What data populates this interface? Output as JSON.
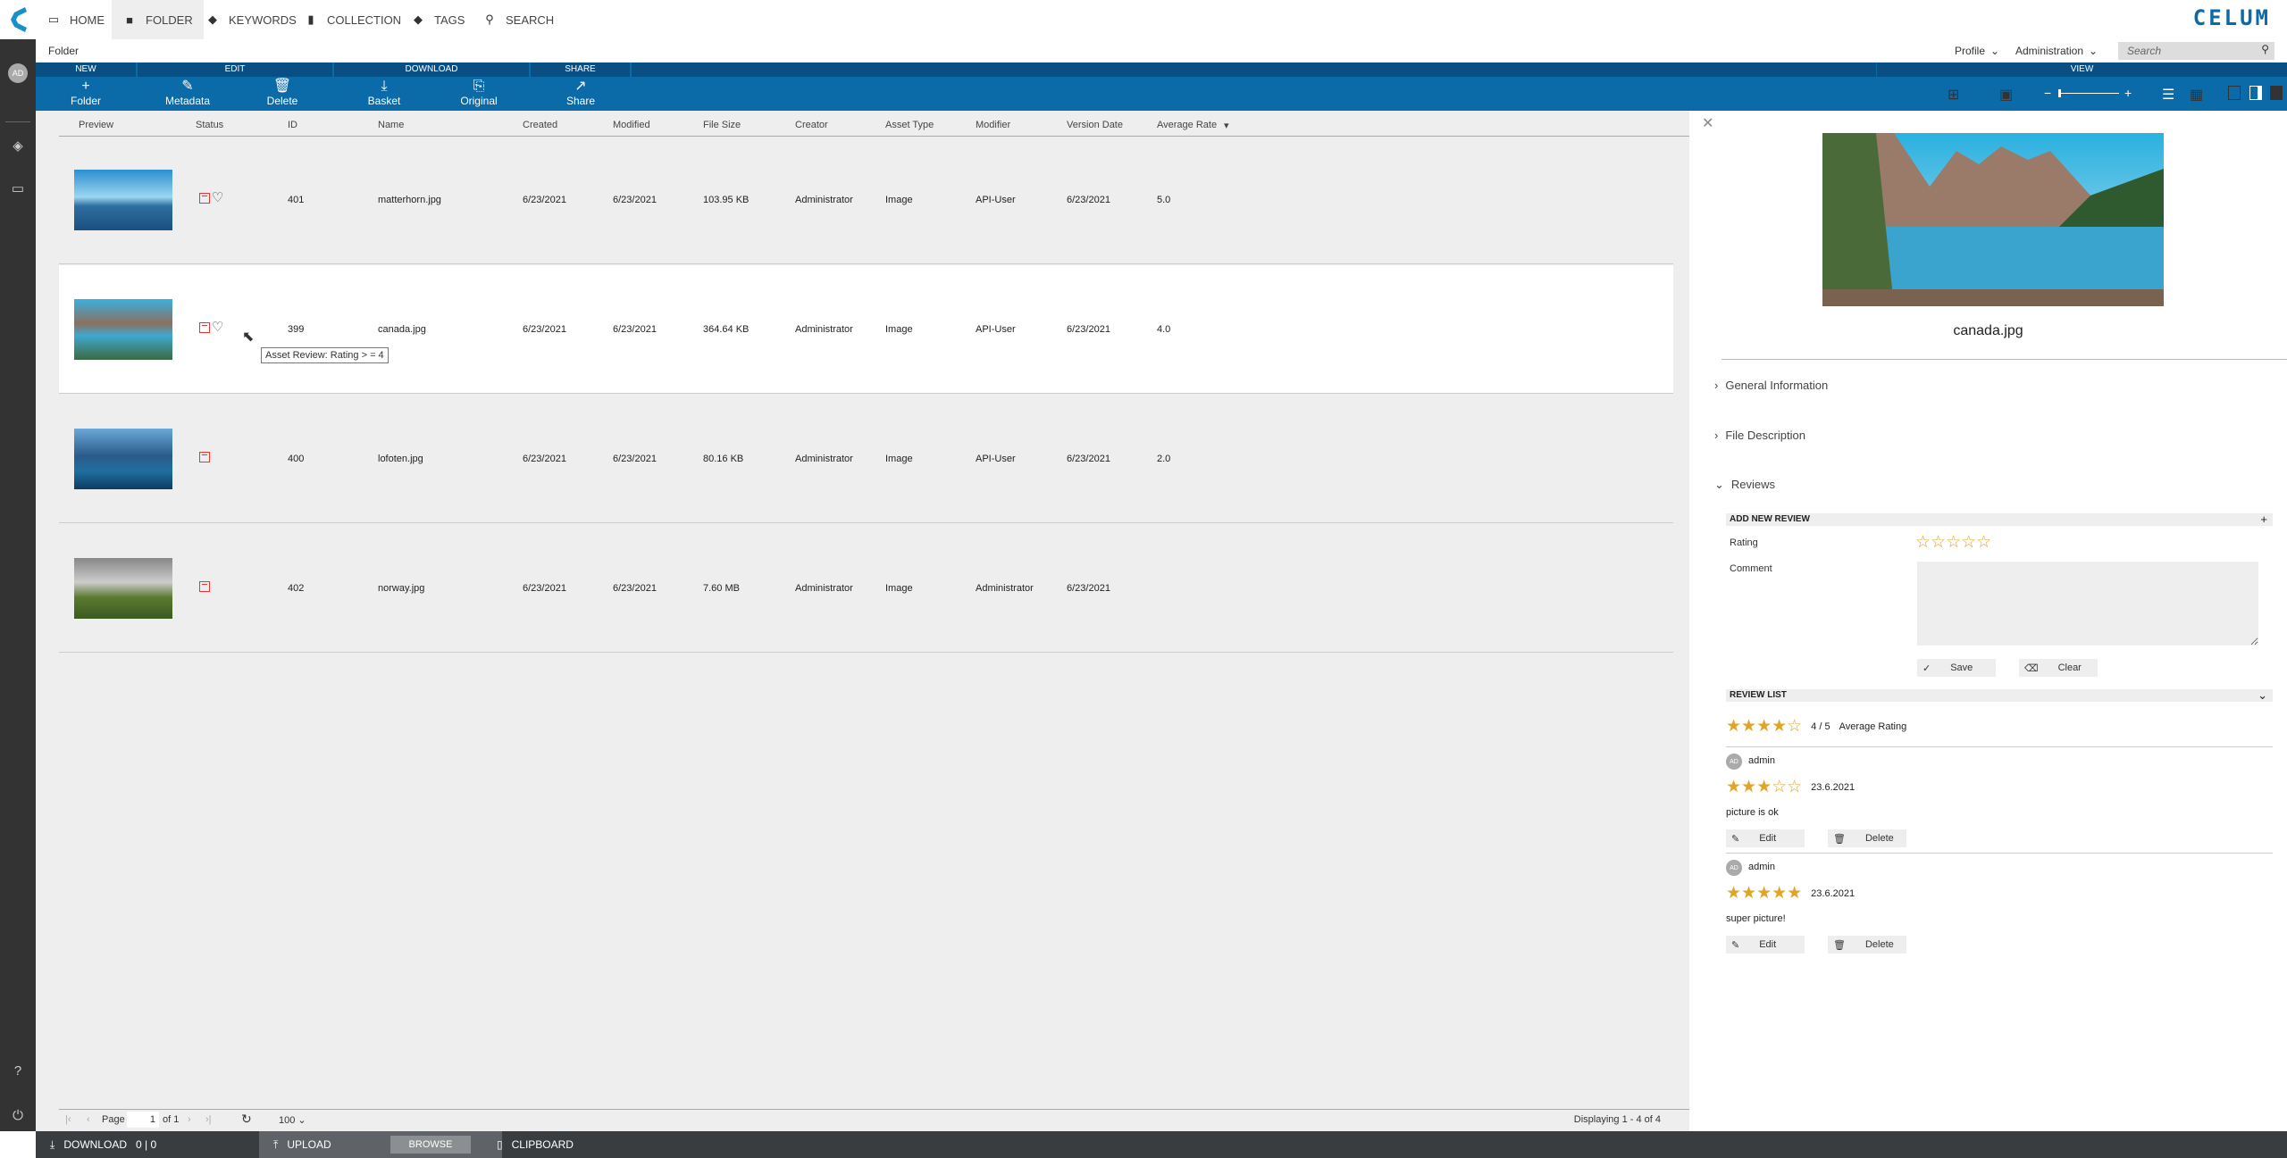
{
  "nav": {
    "items": [
      {
        "label": "HOME",
        "icon": "monitor-icon"
      },
      {
        "label": "FOLDER",
        "icon": "folder-icon",
        "active": true
      },
      {
        "label": "KEYWORDS",
        "icon": "tag-icon"
      },
      {
        "label": "COLLECTION",
        "icon": "collection-icon"
      },
      {
        "label": "TAGS",
        "icon": "tag-icon"
      },
      {
        "label": "SEARCH",
        "icon": "search-icon"
      }
    ],
    "brand": "CELUM"
  },
  "breadcrumb": "Folder",
  "user": {
    "initials": "AD"
  },
  "header": {
    "profile": "Profile",
    "administration": "Administration",
    "search_placeholder": "Search"
  },
  "toolbar": {
    "groups": [
      "NEW",
      "EDIT",
      "DOWNLOAD",
      "SHARE",
      "VIEW"
    ],
    "buttons": [
      "Folder",
      "Metadata",
      "Delete",
      "Basket",
      "Original",
      "Share"
    ]
  },
  "table": {
    "columns": [
      "Preview",
      "Status",
      "ID",
      "Name",
      "Created",
      "Modified",
      "File Size",
      "Creator",
      "Asset Type",
      "Modifier",
      "Version Date",
      "Average Rate"
    ],
    "rows": [
      {
        "id": "401",
        "name": "matterhorn.jpg",
        "created": "6/23/2021",
        "modified": "6/23/2021",
        "size": "103.95 KB",
        "creator": "Administrator",
        "type": "Image",
        "modifier": "API-User",
        "version": "6/23/2021",
        "rate": "5.0",
        "heart": true
      },
      {
        "id": "399",
        "name": "canada.jpg",
        "created": "6/23/2021",
        "modified": "6/23/2021",
        "size": "364.64 KB",
        "creator": "Administrator",
        "type": "Image",
        "modifier": "API-User",
        "version": "6/23/2021",
        "rate": "4.0",
        "heart": true,
        "selected": true
      },
      {
        "id": "400",
        "name": "lofoten.jpg",
        "created": "6/23/2021",
        "modified": "6/23/2021",
        "size": "80.16 KB",
        "creator": "Administrator",
        "type": "Image",
        "modifier": "API-User",
        "version": "6/23/2021",
        "rate": "2.0",
        "heart": false
      },
      {
        "id": "402",
        "name": "norway.jpg",
        "created": "6/23/2021",
        "modified": "6/23/2021",
        "size": "7.60 MB",
        "creator": "Administrator",
        "type": "Image",
        "modifier": "Administrator",
        "version": "6/23/2021",
        "rate": "",
        "heart": false
      }
    ],
    "tooltip": "Asset Review: Rating > = 4"
  },
  "pager": {
    "page_label": "Page",
    "page": "1",
    "of": "of 1",
    "page_size": "100",
    "displaying": "Displaying 1 - 4 of 4"
  },
  "footer": {
    "download": "DOWNLOAD",
    "download_count": "0 | 0",
    "upload": "UPLOAD",
    "browse": "BROWSE",
    "clipboard": "CLIPBOARD"
  },
  "panel": {
    "name": "canada.jpg",
    "sections": [
      "General Information",
      "File Description",
      "Reviews"
    ],
    "add_review": {
      "title": "ADD NEW REVIEW",
      "rating_label": "Rating",
      "comment_label": "Comment",
      "rating": 0,
      "save": "Save",
      "clear": "Clear"
    },
    "review_list": {
      "title": "REVIEW LIST",
      "average": 4,
      "average_text": "4 / 5",
      "average_label": "Average Rating",
      "reviews": [
        {
          "author": "admin",
          "initials": "AD",
          "rating": 3,
          "date": "23.6.2021",
          "comment": "picture is ok"
        },
        {
          "author": "admin",
          "initials": "AD",
          "rating": 5,
          "date": "23.6.2021",
          "comment": "super picture!"
        }
      ],
      "edit": "Edit",
      "delete": "Delete"
    }
  },
  "colors": {
    "toolbar": "#0b6aa8",
    "toolbar_header": "#0a4f84",
    "star": "#e0a526",
    "sidebar": "#333333"
  }
}
